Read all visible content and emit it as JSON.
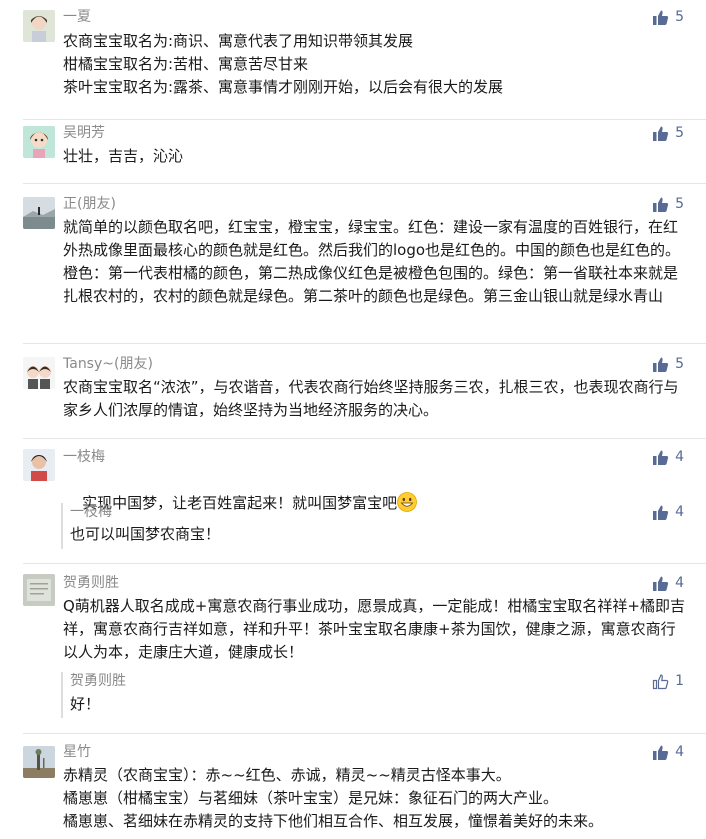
{
  "comments": [
    {
      "name": "一夏",
      "likes": "5",
      "text": "农商宝宝取名为:商识、寓意代表了用知识带领其发展\n柑橘宝宝取名为:苦柑、寓意苦尽甘来\n茶叶宝宝取名为:露茶、寓意事情才刚刚开始，以后会有很大的发展"
    },
    {
      "name": "吴明芳",
      "likes": "5",
      "text": "壮壮，吉吉，沁沁"
    },
    {
      "name": "正(朋友)",
      "likes": "5",
      "text": "就简单的以颜色取名吧，红宝宝，橙宝宝，绿宝宝。红色：建设一家有温度的百姓银行，在红外热成像里面最核心的颜色就是红色。然后我们的logo也是红色的。中国的颜色也是红色的。橙色：第一代表柑橘的颜色，第二热成像仪红色是被橙色包围的。绿色：第一省联社本来就是扎根农村的，农村的颜色就是绿色。第二茶叶的颜色也是绿色。第三金山银山就是绿水青山"
    },
    {
      "name": "Tansy~(朋友)",
      "likes": "5",
      "text": "农商宝宝取名“浓浓”，与农谐音，代表农商行始终坚持服务三农，扎根三农，也表现农商行与家乡人们浓厚的情谊，始终坚持为当地经济服务的决心。"
    },
    {
      "name": "一枝梅",
      "likes": "4",
      "text": "实现中国梦，让老百姓富起来！就叫国梦富宝吧",
      "reply": {
        "name": "一枝梅",
        "likes": "4",
        "text": "也可以叫国梦农商宝！"
      }
    },
    {
      "name": "贺勇则胜",
      "likes": "4",
      "text": "Q萌机器人取名成成+寓意农商行事业成功，愿景成真，一定能成！柑橘宝宝取名祥祥+橘即吉祥，寓意农商行吉祥如意，祥和升平！茶叶宝宝取名康康+茶为国饮，健康之源，寓意农商行以人为本，走康庄大道，健康成长！",
      "reply": {
        "name": "贺勇则胜",
        "likes": "1",
        "text": "好！"
      }
    },
    {
      "name": "星竹",
      "likes": "4",
      "text": "赤精灵（农商宝宝）：赤~~红色、赤诚，精灵~~精灵古怪本事大。\n橘崽崽（柑橘宝宝）与茗细妹（茶叶宝宝）是兄妹：象征石门的两大产业。\n橘崽崽、茗细妹在赤精灵的支持下他们相互合作、相互发展，憧憬着美好的未来。"
    }
  ],
  "colors": {
    "like": "#576b95",
    "name": "#8a8a8a"
  }
}
